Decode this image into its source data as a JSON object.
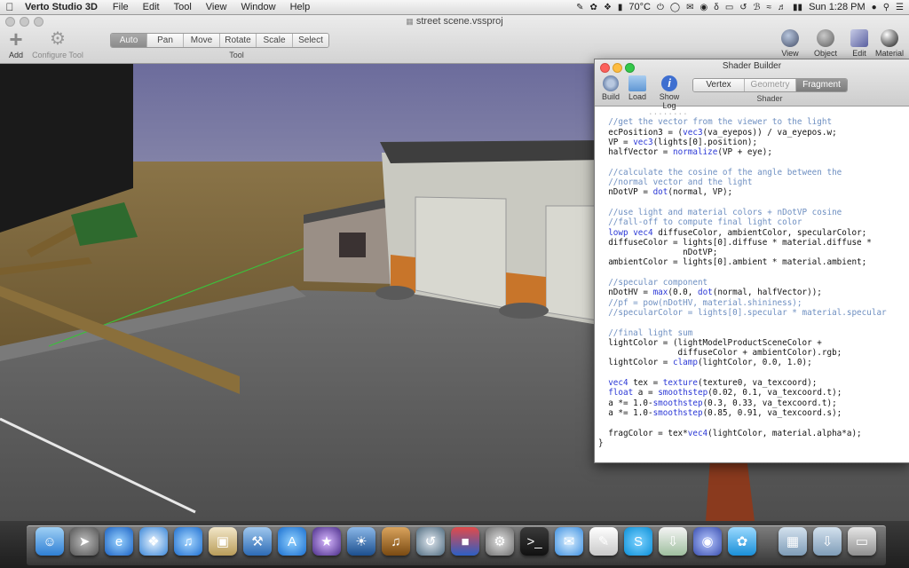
{
  "menubar": {
    "app_name": "Verto Studio 3D",
    "menus": [
      "File",
      "Edit",
      "Tool",
      "View",
      "Window",
      "Help"
    ],
    "temperature": "70°C",
    "clock": "Sun 1:28 PM"
  },
  "window": {
    "title": "street scene.vssproj",
    "add_label": "Add",
    "configure_label": "Configure Tool",
    "tool_segments": [
      "Auto",
      "Pan",
      "Move",
      "Rotate",
      "Scale",
      "Select"
    ],
    "tool_caption": "Tool",
    "right_buttons": [
      "View",
      "Object List",
      "Edit",
      "Material"
    ]
  },
  "shader": {
    "title": "Shader Builder",
    "buttons": [
      "Build",
      "Load",
      "Show Log"
    ],
    "segments": [
      "Vertex",
      "Geometry",
      "Fragment"
    ],
    "caption": "Shader",
    "code": [
      "  //get the vector from the viewer to the light",
      "  ecPosition3 = (vec3(va_eyepos)) / va_eyepos.w;",
      "  VP = vec3(lights[0].position);",
      "  halfVector = normalize(VP + eye);",
      "",
      "  //calculate the cosine of the angle between the",
      "  //normal vector and the light",
      "  nDotVP = dot(normal, VP);",
      "",
      "  //use light and material colors + nDotVP cosine",
      "  //fall-off to compute final light color",
      "  lowp vec4 diffuseColor, ambientColor, specularColor;",
      "  diffuseColor = lights[0].diffuse * material.diffuse *",
      "                 nDotVP;",
      "  ambientColor = lights[0].ambient * material.ambient;",
      "",
      "  //specular component",
      "  nDotHV = max(0.0, dot(normal, halfVector));",
      "  //pf = pow(nDotHV, material.shininess);",
      "  //specularColor = lights[0].specular * material.specular",
      "",
      "  //final light sum",
      "  lightColor = (lightModelProductSceneColor +",
      "                diffuseColor + ambientColor).rgb;",
      "  lightColor = clamp(lightColor, 0.0, 1.0);",
      "",
      "  vec4 tex = texture(texture0, va_texcoord);",
      "  float a = smoothstep(0.02, 0.1, va_texcoord.t);",
      "  a *= 1.0-smoothstep(0.3, 0.33, va_texcoord.t);",
      "  a *= 1.0-smoothstep(0.85, 0.91, va_texcoord.s);",
      "",
      "  fragColor = tex*vec4(lightColor, material.alpha*a);",
      "}"
    ]
  },
  "dock": {
    "apps": [
      "finder-icon",
      "launchpad-icon",
      "internet-explorer-icon",
      "safari-icon",
      "itunes-icon",
      "preview-icon",
      "xcode-icon",
      "app-store-icon",
      "imovie-icon",
      "iphoto-icon",
      "garageband-icon",
      "time-machine-icon",
      "parallels-icon",
      "system-preferences-icon",
      "terminal-icon",
      "messages-icon",
      "textedit-icon",
      "skype-icon",
      "downloader-icon",
      "vpn-icon",
      "twitter-icon",
      "documents-icon",
      "downloads-icon",
      "trash-icon"
    ]
  },
  "colors": {
    "menubar": "#dcdcdc",
    "segment_active": "#8b8b8b",
    "code_comment": "#6e8fc1",
    "code_keyword": "#2b38d6"
  }
}
